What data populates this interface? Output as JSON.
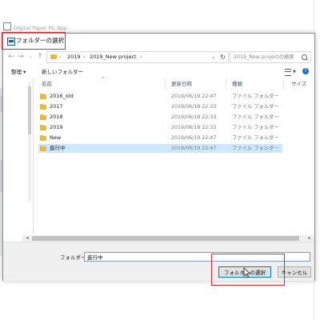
{
  "background_app": {
    "title": "Digital Paper PC App"
  },
  "dialog": {
    "title": "フォルダーの選択",
    "nav": {
      "back_icon": "back-arrow-icon",
      "forward_icon": "forward-arrow-icon",
      "recent_icon": "chevron-down-icon",
      "up_icon": "up-arrow-icon"
    },
    "address": {
      "crumbs": [
        "2019",
        "2019_New project"
      ],
      "separator": "›"
    },
    "search": {
      "placeholder": "2019_New projectの検索"
    },
    "toolbar": {
      "organize": "整理 ▾",
      "new_folder": "新しいフォルダー",
      "help": "?"
    },
    "columns": {
      "name": "名前",
      "date": "更新日時",
      "type": "種類",
      "size": "サイズ"
    },
    "files": [
      {
        "name": "2016_old",
        "date": "2019/06/19 22:47",
        "type": "ファイル フォルダー",
        "selected": false
      },
      {
        "name": "2017",
        "date": "2019/06/18 22:33",
        "type": "ファイル フォルダー",
        "selected": false
      },
      {
        "name": "2018",
        "date": "2019/06/18 22:33",
        "type": "ファイル フォルダー",
        "selected": false
      },
      {
        "name": "2019",
        "date": "2019/06/18 22:33",
        "type": "ファイル フォルダー",
        "selected": false
      },
      {
        "name": "New",
        "date": "2019/06/19 22:47",
        "type": "ファイル フォルダー",
        "selected": false
      },
      {
        "name": "進行中",
        "date": "2019/06/19 22:47",
        "type": "ファイル フォルダー",
        "selected": true
      }
    ],
    "folder_label": "フォルダー:",
    "folder_value": "進行中",
    "select_button": "フォルダーの選択",
    "cancel_button": "キャンセル"
  },
  "colors": {
    "highlight": "#e0282e",
    "selection": "#cce8ff",
    "folder": "#e8b93d"
  }
}
